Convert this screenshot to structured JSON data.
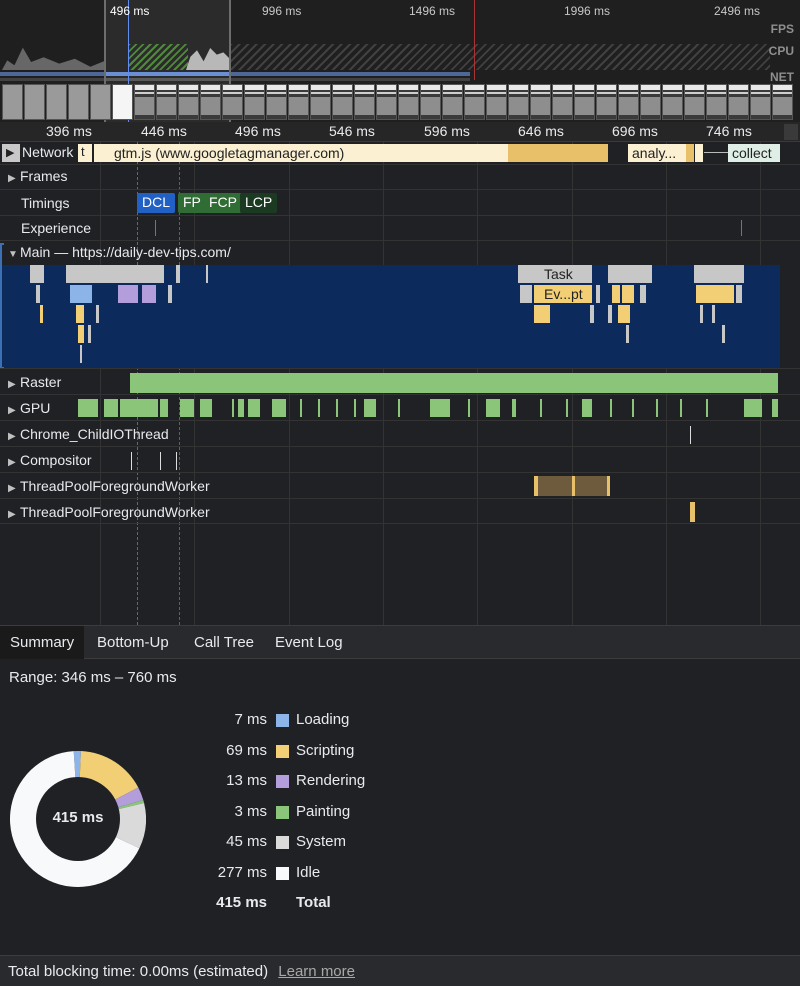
{
  "overview": {
    "ticks": [
      "496 ms",
      "996 ms",
      "1496 ms",
      "1996 ms",
      "2496 ms"
    ],
    "labels": {
      "fps": "FPS",
      "cpu": "CPU",
      "net": "NET"
    }
  },
  "ruler": {
    "ticks": [
      "396 ms",
      "446 ms",
      "496 ms",
      "546 ms",
      "596 ms",
      "646 ms",
      "696 ms",
      "746 ms"
    ]
  },
  "tracks": {
    "network": {
      "label": "Network",
      "requests": [
        "t",
        "gtm.js (www.googletagmanager.com)",
        "analy...",
        "collect"
      ]
    },
    "frames": {
      "label": "Frames"
    },
    "timings": {
      "label": "Timings",
      "markers": [
        "DCL",
        "FP",
        "FCP",
        "LCP"
      ]
    },
    "experience": {
      "label": "Experience"
    },
    "main": {
      "label": "Main — https://daily-dev-tips.com/",
      "slices": [
        "Task",
        "Ev...pt"
      ]
    },
    "raster": {
      "label": "Raster"
    },
    "gpu": {
      "label": "GPU"
    },
    "io_thread": {
      "label": "Chrome_ChildIOThread"
    },
    "compositor": {
      "label": "Compositor"
    },
    "worker1": {
      "label": "ThreadPoolForegroundWorker"
    },
    "worker2": {
      "label": "ThreadPoolForegroundWorker"
    }
  },
  "tabs": [
    "Summary",
    "Bottom-Up",
    "Call Tree",
    "Event Log"
  ],
  "summary": {
    "range": "Range: 346 ms – 760 ms",
    "donut_total": "415 ms",
    "categories": [
      {
        "value": "7 ms",
        "name": "Loading",
        "ms": 7,
        "color": "#8cb4e8"
      },
      {
        "value": "69 ms",
        "name": "Scripting",
        "ms": 69,
        "color": "#f2cf75"
      },
      {
        "value": "13 ms",
        "name": "Rendering",
        "ms": 13,
        "color": "#b39ddb"
      },
      {
        "value": "3 ms",
        "name": "Painting",
        "ms": 3,
        "color": "#8bc57a"
      },
      {
        "value": "45 ms",
        "name": "System",
        "ms": 45,
        "color": "#dadada"
      },
      {
        "value": "277 ms",
        "name": "Idle",
        "ms": 277,
        "color": "#f8f9fa"
      }
    ],
    "total": {
      "value": "415 ms",
      "name": "Total"
    }
  },
  "footer": {
    "text": "Total blocking time: 0.00ms (estimated)",
    "link": "Learn more"
  }
}
